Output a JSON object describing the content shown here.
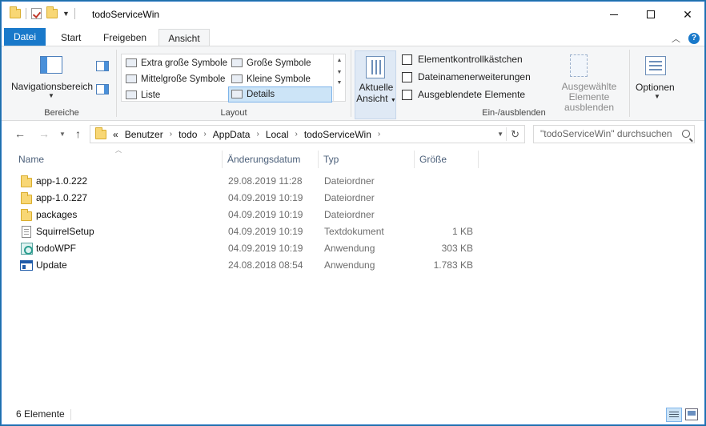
{
  "window": {
    "title": "todoServiceWin"
  },
  "tabs": [
    "Datei",
    "Start",
    "Freigeben",
    "Ansicht"
  ],
  "ribbon": {
    "bereiche": {
      "nav_pane_label": "Navigationsbereich",
      "group_label": "Bereiche"
    },
    "layout": {
      "items": [
        "Extra große Symbole",
        "Große Symbole",
        "Mittelgroße Symbole",
        "Kleine Symbole",
        "Liste",
        "Details"
      ],
      "selected": "Details",
      "group_label": "Layout"
    },
    "current_view": {
      "label_line1": "Aktuelle",
      "label_line2": "Ansicht"
    },
    "show_hide": {
      "checkboxes": [
        "Elementkontrollkästchen",
        "Dateinamenerweiterungen",
        "Ausgeblendete Elemente"
      ],
      "hide_selected_line1": "Ausgewählte",
      "hide_selected_line2": "Elemente ausblenden",
      "group_label": "Ein-/ausblenden"
    },
    "options": {
      "label": "Optionen"
    }
  },
  "address": {
    "prefix": "«",
    "crumbs": [
      "Benutzer",
      "todo",
      "AppData",
      "Local",
      "todoServiceWin"
    ],
    "search_placeholder": "\"todoServiceWin\" durchsuchen"
  },
  "columns": {
    "name": "Name",
    "date": "Änderungsdatum",
    "type": "Typ",
    "size": "Größe"
  },
  "files": [
    {
      "name": "app-1.0.222",
      "date": "29.08.2019 11:28",
      "type": "Dateiordner",
      "size": "",
      "icon": "folder-icon"
    },
    {
      "name": "app-1.0.227",
      "date": "04.09.2019 10:19",
      "type": "Dateiordner",
      "size": "",
      "icon": "folder-icon"
    },
    {
      "name": "packages",
      "date": "04.09.2019 10:19",
      "type": "Dateiordner",
      "size": "",
      "icon": "folder-icon"
    },
    {
      "name": "SquirrelSetup",
      "date": "04.09.2019 10:19",
      "type": "Textdokument",
      "size": "1 KB",
      "icon": "text-document-icon"
    },
    {
      "name": "todoWPF",
      "date": "04.09.2019 10:19",
      "type": "Anwendung",
      "size": "303 KB",
      "icon": "application-icon"
    },
    {
      "name": "Update",
      "date": "24.08.2018 08:54",
      "type": "Anwendung",
      "size": "1.783 KB",
      "icon": "update-app-icon"
    }
  ],
  "status": {
    "count": "6 Elemente"
  }
}
